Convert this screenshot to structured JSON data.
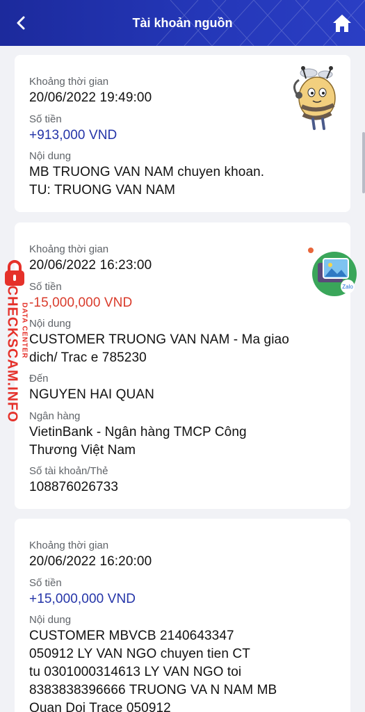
{
  "header": {
    "title": "Tài khoản nguồn",
    "back_icon": "chevron-left-icon",
    "home_icon": "home-icon",
    "colors": {
      "gradient_start": "#1c2a9c",
      "gradient_end": "#2a3ec4"
    }
  },
  "colors": {
    "credit": "#2434a8",
    "debit": "#d93b2b",
    "label": "#5f6368",
    "background": "#f1f2f6"
  },
  "transactions": [
    {
      "time_label": "Khoảng thời gian",
      "time": "20/06/2022 19:49:00",
      "amount_label": "Số tiền",
      "amount": "+913,000 VND",
      "content_label": "Nội dung",
      "content_line1": "MB TRUONG VAN NAM chuyen khoan.",
      "content_line2": "TU: TRUONG VAN NAM"
    },
    {
      "time_label": "Khoảng thời gian",
      "time": "20/06/2022 16:23:00",
      "amount_label": "Số tiền",
      "amount": "-15,000,000 VND",
      "content_label": "Nội dung",
      "content_line1": "CUSTOMER TRUONG VAN NAM - Ma giao",
      "content_line2": "dich/ Trac e 785230",
      "to_label": "Đến",
      "to": "NGUYEN HAI QUAN",
      "bank_label": "Ngân hàng",
      "bank_line1": "VietinBank - Ngân hàng TMCP Công",
      "bank_line2": "Thương Việt Nam",
      "account_label": "Số tài khoản/Thẻ",
      "account": "108876026733"
    },
    {
      "time_label": "Khoảng thời gian",
      "time": "20/06/2022 16:20:00",
      "amount_label": "Số tiền",
      "amount": "+15,000,000 VND",
      "content_label": "Nội dung",
      "content_line1": "CUSTOMER MBVCB 2140643347",
      "content_line2": "050912 LY VAN NGO  chuyen tien CT",
      "content_line3": "tu 0301000314613 LY  VAN NGO toi",
      "content_line4": "8383838396666 TRUONG VA N NAM  MB",
      "content_line5": "Quan Doi Trace 050912"
    }
  ],
  "overlays": {
    "zalo_label": "Zalo",
    "watermark_main": "CHECKSCAM.INFO",
    "watermark_sub": "DATA CENTER"
  }
}
